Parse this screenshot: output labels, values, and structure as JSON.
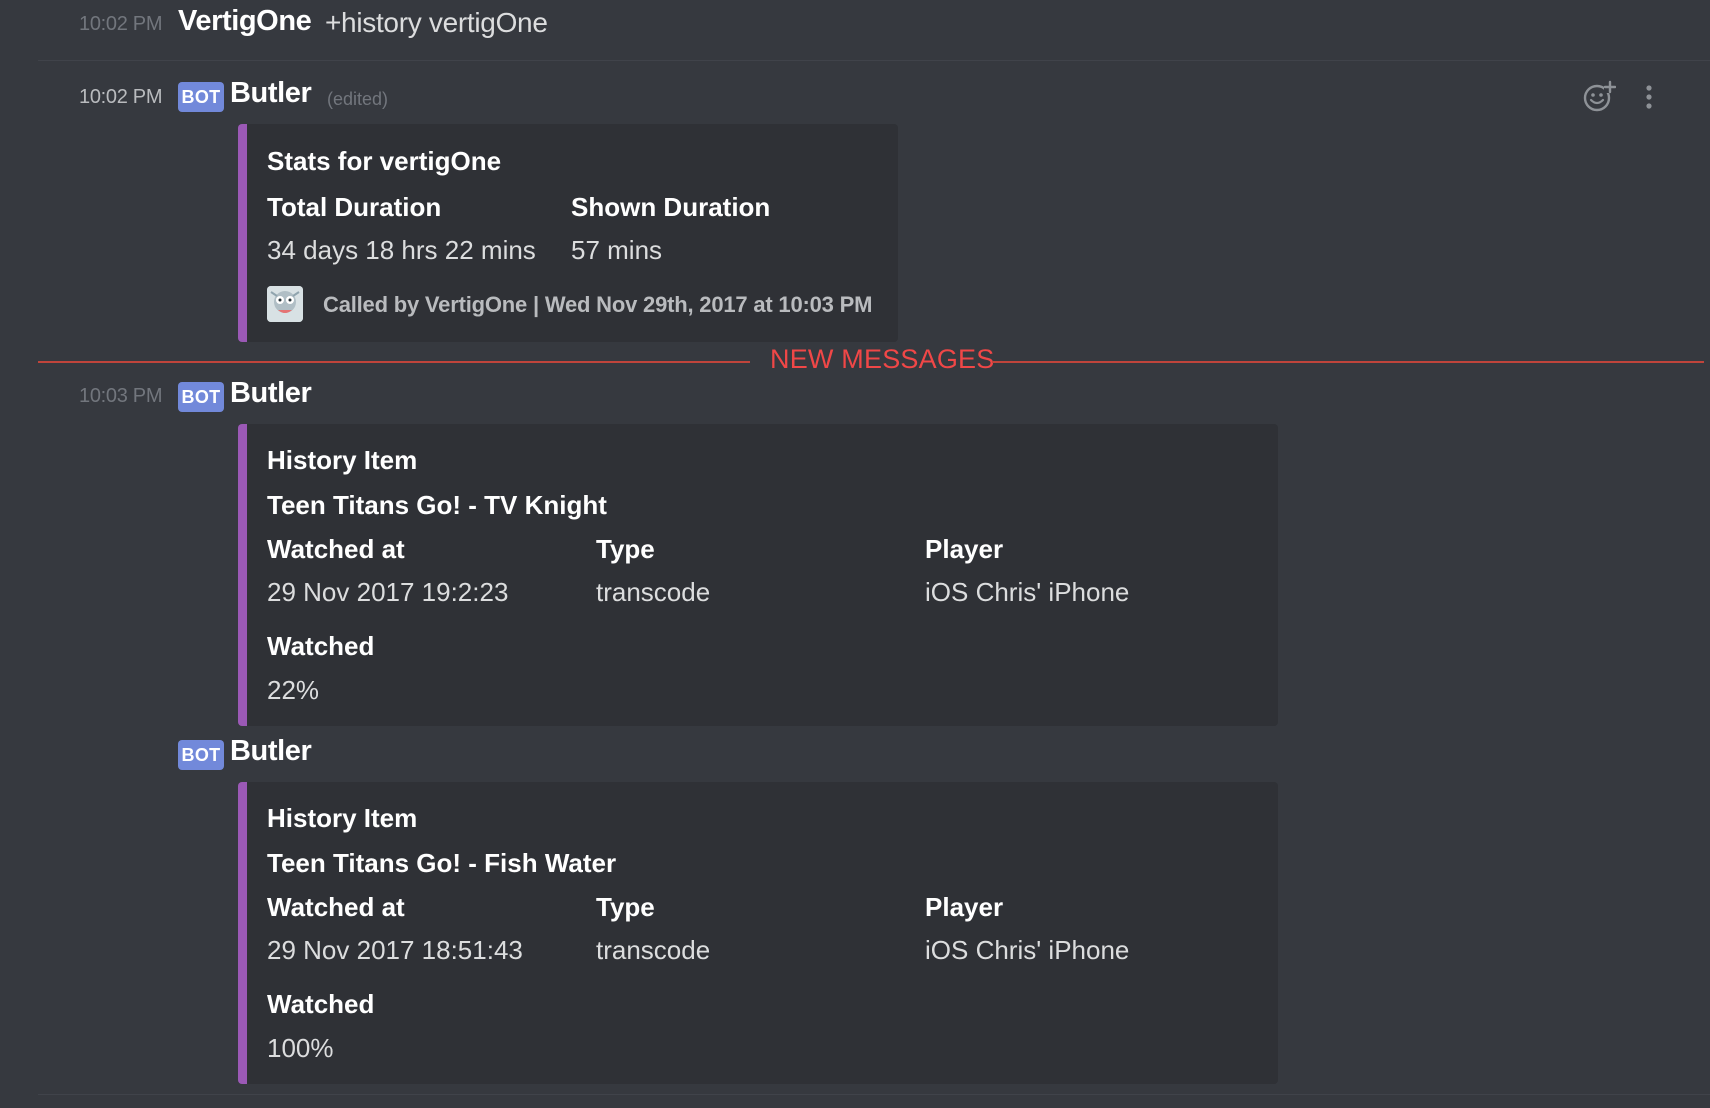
{
  "messages": {
    "command": {
      "time": "10:02 PM",
      "author": "VertigOne",
      "text": "+history vertigOne"
    },
    "stats": {
      "time": "10:02 PM",
      "bot_tag": "BOT",
      "author": "Butler",
      "edited": "(edited)",
      "embed": {
        "title": "Stats for vertigOne",
        "fields": [
          {
            "name": "Total Duration",
            "value": "34 days 18 hrs 22 mins"
          },
          {
            "name": "Shown Duration",
            "value": "57 mins"
          }
        ],
        "footer": "Called by VertigOne | Wed Nov 29th, 2017 at 10:03 PM"
      }
    },
    "new_messages_label": "NEW MESSAGES",
    "history1": {
      "time": "10:03 PM",
      "bot_tag": "BOT",
      "author": "Butler",
      "embed": {
        "title": "History Item",
        "subtitle": "Teen Titans Go! - TV Knight",
        "fields": [
          {
            "name": "Watched at",
            "value": "29 Nov 2017 19:2:23"
          },
          {
            "name": "Type",
            "value": "transcode"
          },
          {
            "name": "Player",
            "value": "iOS Chris' iPhone"
          },
          {
            "name": "Watched",
            "value": "22%"
          }
        ]
      }
    },
    "history2": {
      "bot_tag": "BOT",
      "author": "Butler",
      "embed": {
        "title": "History Item",
        "subtitle": "Teen Titans Go! - Fish Water",
        "fields": [
          {
            "name": "Watched at",
            "value": "29 Nov 2017 18:51:43"
          },
          {
            "name": "Type",
            "value": "transcode"
          },
          {
            "name": "Player",
            "value": "iOS Chris' iPhone"
          },
          {
            "name": "Watched",
            "value": "100%"
          }
        ]
      }
    }
  },
  "icons": {
    "add_reaction": "add-reaction-icon",
    "more": "more-options-icon"
  },
  "colors": {
    "background": "#36393f",
    "embed_background": "#2f3136",
    "embed_accent": "#9b59b6",
    "bot_tag": "#7289da",
    "new_messages": "#f04747"
  }
}
